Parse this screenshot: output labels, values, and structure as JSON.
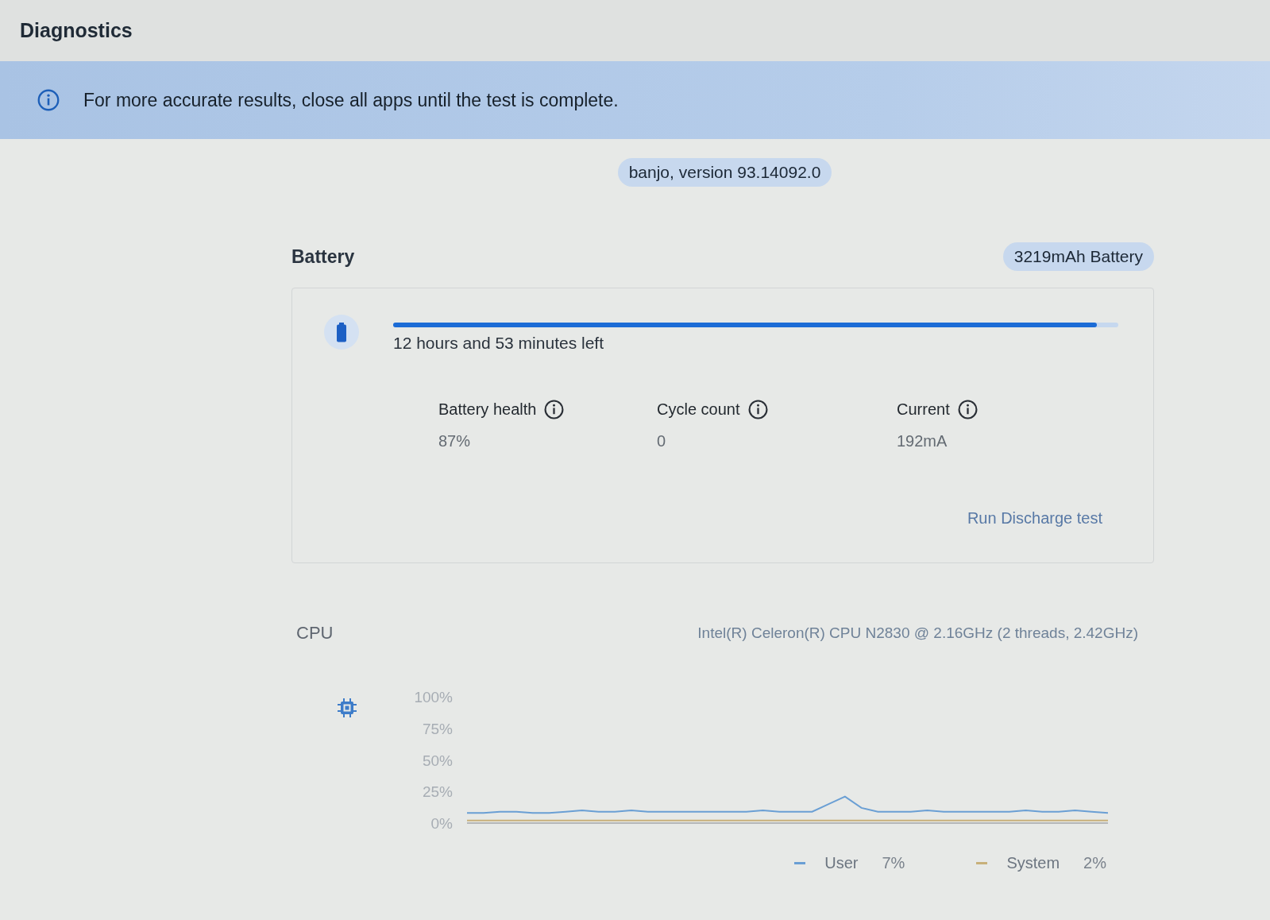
{
  "header": {
    "title": "Diagnostics"
  },
  "banner": {
    "message": "For more accurate results, close all apps until the test is complete."
  },
  "version_badge": "banjo, version 93.14092.0",
  "battery": {
    "title": "Battery",
    "badge": "3219mAh Battery",
    "charge": {
      "level": 0.97
    },
    "time_left": "12 hours and 53 minutes left",
    "stats": [
      {
        "label": "Battery health",
        "value": "87%"
      },
      {
        "label": "Cycle count",
        "value": "0"
      },
      {
        "label": "Current",
        "value": "192mA"
      }
    ],
    "action": "Run Discharge test"
  },
  "cpu": {
    "title": "CPU",
    "model": "Intel(R) Celeron(R) CPU N2830 @ 2.16GHz (2 threads, 2.42GHz)",
    "chart_data": {
      "type": "line",
      "ylim": [
        0,
        100
      ],
      "yticks": [
        {
          "value": 0,
          "label": "0%"
        },
        {
          "value": 25,
          "label": "25%"
        },
        {
          "value": 50,
          "label": "50%"
        },
        {
          "value": 75,
          "label": "75%"
        },
        {
          "value": 100,
          "label": "100%"
        }
      ],
      "tick_labels": "y",
      "legend": "bottom right",
      "series": [
        {
          "name": "User",
          "color": "#6a9fd4",
          "values": [
            8,
            8,
            9,
            9,
            8,
            8,
            9,
            10,
            9,
            9,
            10,
            9,
            9,
            9,
            9,
            9,
            9,
            9,
            10,
            9,
            9,
            9,
            15,
            21,
            12,
            9,
            9,
            9,
            10,
            9,
            9,
            9,
            9,
            9,
            10,
            9,
            9,
            10,
            9,
            8
          ]
        },
        {
          "name": "System",
          "color": "#c8b07a",
          "values": [
            2,
            2,
            2,
            2,
            2,
            2,
            2,
            2,
            2,
            2,
            2,
            2,
            2,
            2,
            2,
            2,
            2,
            2,
            2,
            2,
            2,
            2,
            2,
            2,
            2,
            2,
            2,
            2,
            2,
            2,
            2,
            2,
            2,
            2,
            2,
            2,
            2,
            2,
            2,
            2
          ]
        }
      ]
    },
    "readings": [
      "7%",
      "2%"
    ]
  }
}
